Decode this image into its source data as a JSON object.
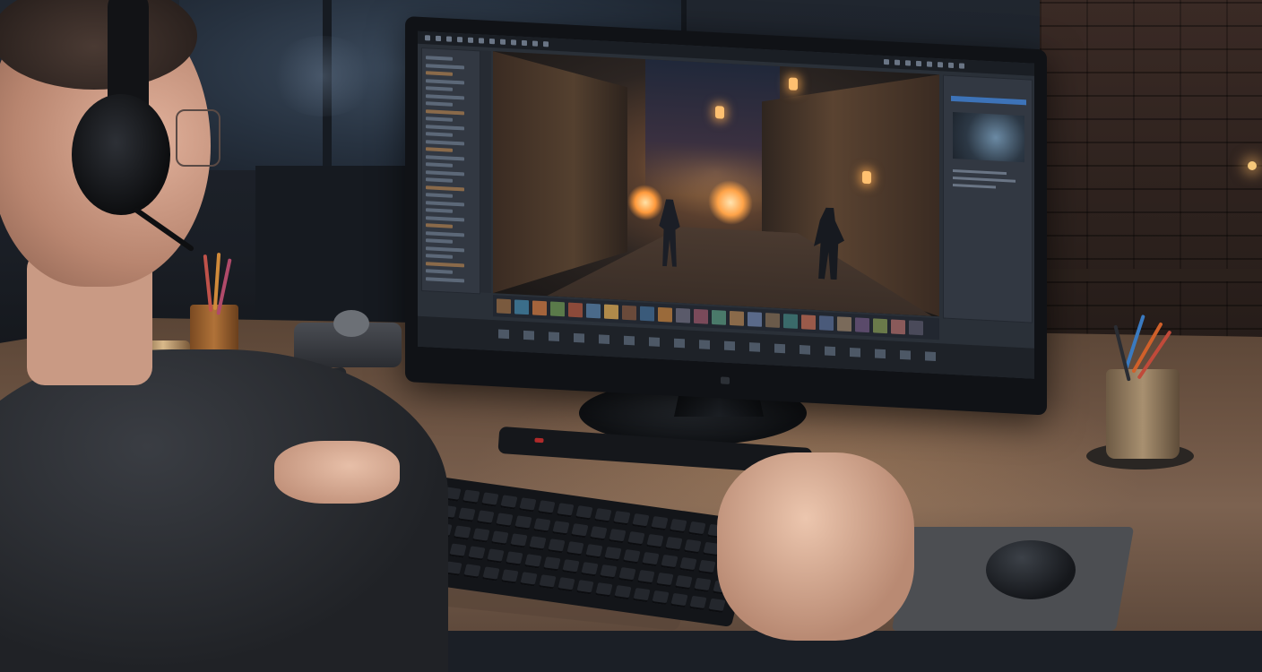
{
  "scene": {
    "description_type": "photo",
    "colors": {
      "screen_accent": "#3d73b8",
      "fire_glow": "#ffa348",
      "desk_wood": "#6e5544"
    }
  },
  "editor": {
    "timeline_thumb_colors": [
      "#7a5a3e",
      "#3b6e8a",
      "#a4643c",
      "#5a7a4a",
      "#8c4a3a",
      "#4a6a8a",
      "#b08a4a",
      "#6a4a3a",
      "#3a5a7a",
      "#9a6a3a",
      "#5a5a6a",
      "#7a4a5a",
      "#4a7a6a",
      "#8a6a4a",
      "#5a6a8a",
      "#6a5a4a",
      "#3a6a6a",
      "#9a5a4a",
      "#4a5a7a",
      "#7a6a5a",
      "#5a4a6a",
      "#6a7a4a",
      "#8a5a5a",
      "#4a4a5a"
    ]
  }
}
